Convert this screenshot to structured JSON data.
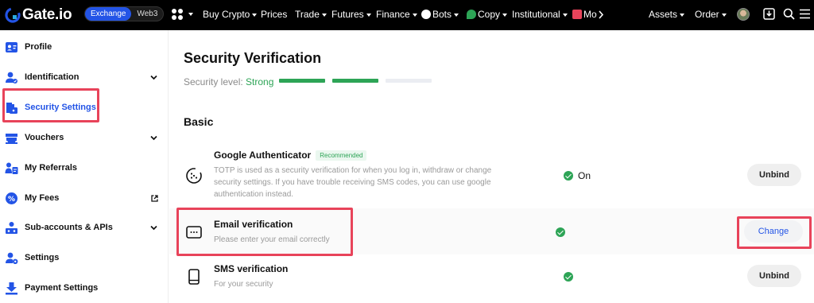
{
  "colors": {
    "accent": "#2354e6",
    "success": "#2da456",
    "highlight": "#e8435a",
    "nav_bg": "#000000"
  },
  "header": {
    "logo": "Gate.io",
    "mode_toggle": {
      "active": "Exchange",
      "inactive": "Web3"
    },
    "nav": [
      "Buy Crypto",
      "Prices",
      "Trade",
      "Futures",
      "Finance",
      "Bots",
      "Copy",
      "Institutional",
      "Mo"
    ],
    "right": [
      "Assets",
      "Order"
    ],
    "icons": [
      "apps-icon",
      "avatar",
      "download-icon",
      "search-icon",
      "menu-icon"
    ]
  },
  "sidebar": {
    "items": [
      {
        "label": "Profile",
        "icon": "profile-icon"
      },
      {
        "label": "Identification",
        "icon": "identification-icon"
      },
      {
        "label": "Security Settings",
        "icon": "security-icon"
      },
      {
        "label": "Vouchers",
        "icon": "voucher-icon"
      },
      {
        "label": "My Referrals",
        "icon": "referrals-icon"
      },
      {
        "label": "My Fees",
        "icon": "fees-icon"
      },
      {
        "label": "Sub-accounts & APIs",
        "icon": "sub-accounts-icon"
      },
      {
        "label": "Settings",
        "icon": "settings-icon"
      },
      {
        "label": "Payment Settings",
        "icon": "payment-icon"
      }
    ]
  },
  "main": {
    "title": "Security Verification",
    "security_level_label": "Security level:",
    "security_level_value": "Strong",
    "security_level_filled": 2,
    "security_level_total": 3,
    "section_title": "Basic",
    "rows": [
      {
        "title": "Google Authenticator",
        "badge": "Recommended",
        "desc": "TOTP is used as a security verification for when you log in, withdraw or change security settings. If you have trouble receiving SMS codes, you can use google authentication instead.",
        "status": "On",
        "button": "Unbind"
      },
      {
        "title": "Email verification",
        "desc": "Please enter your email correctly",
        "status": "",
        "button": "Change"
      },
      {
        "title": "SMS verification",
        "desc": "For your security",
        "status": "",
        "button": "Unbind"
      }
    ]
  }
}
